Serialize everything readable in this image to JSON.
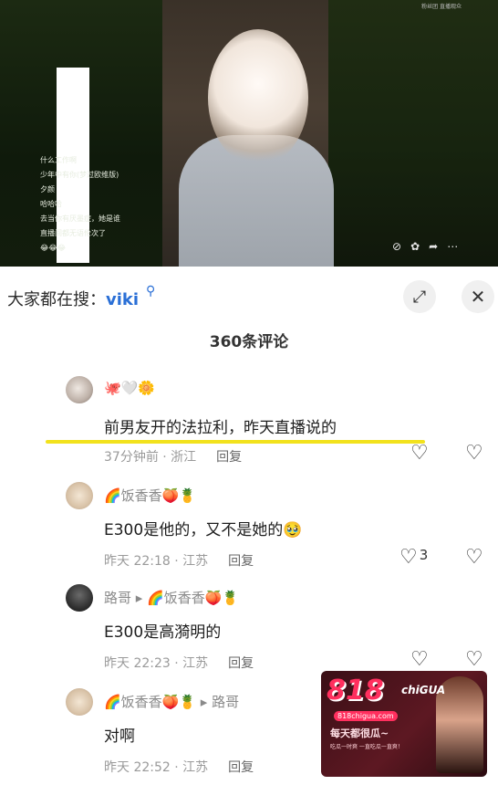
{
  "video": {
    "live_comments": [
      "什么工作啊",
      "少年中有你(梦过欧维版)",
      "夕颜",
      "哈哈哈",
      "去当你有厌墨症，她是谁",
      "直播间都无语伦次了",
      "😂😂😂"
    ],
    "corner_text": "粉丝团 直播观众"
  },
  "search": {
    "prefix": "大家都在搜：",
    "term": "viki"
  },
  "icons": {
    "search": "search-icon",
    "expand": "expand-icon",
    "close": "close-icon",
    "heart": "heart-outline-icon",
    "broken_heart": "broken-heart-icon"
  },
  "comments_count": "360条评论",
  "comments": [
    {
      "name_badges": "🐙🤍🌼",
      "text": "前男友开的法拉利，昨天直播说的",
      "time": "37分钟前 · 浙江",
      "reply_label": "回复",
      "likes": ""
    },
    {
      "name": "🌈饭香香🍑🍍",
      "text": "E300是他的，又不是她的🥹",
      "time": "昨天 22:18 · 江苏",
      "reply_label": "回复",
      "likes": "3"
    },
    {
      "name": "路哥 ▸ 🌈饭香香🍑🍍",
      "text": "E300是高漪明的",
      "time": "昨天 22:23 · 江苏",
      "reply_label": "回复",
      "likes": ""
    },
    {
      "name": "🌈饭香香🍑🍍 ▸ 路哥",
      "text": "对啊",
      "time": "昨天 22:52 · 江苏",
      "reply_label": "回复",
      "likes": ""
    }
  ],
  "ad": {
    "logo": "818",
    "sub": "chiGUA",
    "url": "818chigua.com",
    "slogan": "每天都很瓜~",
    "tag": "吃瓜一时爽 一直吃瓜一直爽！"
  }
}
